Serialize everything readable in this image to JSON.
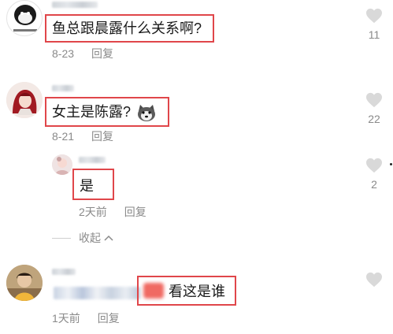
{
  "comments": [
    {
      "text": "鱼总跟晨露什么关系啊?",
      "date": "8-23",
      "reply_label": "回复",
      "likes": "11"
    },
    {
      "text": "女主是陈露?",
      "date": "8-21",
      "reply_label": "回复",
      "likes": "22"
    }
  ],
  "reply": {
    "text": "是",
    "date": "2天前",
    "reply_label": "回复",
    "likes": "2"
  },
  "collapse_label": "收起",
  "comment3": {
    "text": "看这是谁",
    "date": "1天前",
    "reply_label": "回复"
  },
  "icons": {
    "like": "heart-icon",
    "collapse": "chevron-up-icon",
    "emoji": "husky-emoji-icon"
  },
  "colors": {
    "highlight_box": "#e0464a",
    "meta_text": "#8a8a8a",
    "like_icon": "#d9d9d9"
  }
}
